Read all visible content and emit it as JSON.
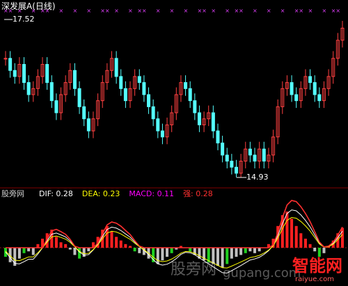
{
  "header": {
    "title": "深发展A",
    "period": "(日线)"
  },
  "price_pane": {
    "high_marker": "17.52",
    "low_marker": "14.93",
    "signal_row_color": "#e040fb",
    "up_color": "#ff4040",
    "down_color": "#54ffff"
  },
  "macd_pane": {
    "indicator_name": "股旁网",
    "dif_label": "DIF:",
    "dif_value": "0.28",
    "dea_label": "DEA:",
    "dea_value": "0.23",
    "macd_label": "MACD:",
    "macd_value": "0.11",
    "strong_label": "强:",
    "strong_value": "0.28",
    "colors": {
      "dif": "#ffffff",
      "dea": "#ffff00",
      "macd": "#ff00ff",
      "strong": "#ff3030",
      "hist_up": "#ff2020",
      "hist_down": "#c0c0c0",
      "hist_green": "#20d020"
    }
  },
  "watermark": {
    "left_text": "股旁网",
    "right_text": "智能网",
    "url": "gupang.com",
    "sub_url": "raiyue.com"
  },
  "chart_data": {
    "type": "candlestick",
    "series_ohlc_note": "approximate daily bars read from image",
    "price_high": 17.52,
    "price_low": 14.93,
    "closes": [
      16.9,
      16.7,
      16.6,
      16.8,
      16.5,
      16.3,
      16.4,
      16.6,
      16.8,
      16.5,
      16.2,
      16.0,
      16.3,
      16.5,
      16.7,
      16.4,
      16.1,
      15.9,
      15.7,
      15.9,
      16.2,
      16.5,
      16.7,
      16.9,
      16.6,
      16.4,
      16.2,
      16.4,
      16.6,
      16.5,
      16.3,
      16.1,
      15.9,
      15.7,
      15.6,
      15.8,
      16.0,
      16.3,
      16.5,
      16.4,
      16.2,
      16.0,
      15.8,
      15.9,
      16.0,
      15.7,
      15.5,
      15.3,
      15.2,
      15.1,
      15.0,
      15.2,
      15.4,
      15.3,
      15.2,
      15.4,
      15.2,
      15.3,
      15.6,
      16.1,
      16.4,
      16.5,
      16.3,
      16.2,
      16.4,
      16.6,
      16.5,
      16.3,
      16.2,
      16.4,
      16.6,
      16.9,
      17.2,
      17.4
    ],
    "macd_hist": [
      -0.05,
      -0.08,
      -0.1,
      -0.06,
      -0.03,
      -0.02,
      -0.04,
      0.02,
      0.05,
      0.08,
      0.1,
      0.06,
      0.03,
      0.02,
      -0.01,
      -0.04,
      -0.06,
      -0.05,
      -0.02,
      0.03,
      0.06,
      0.1,
      0.12,
      0.09,
      0.06,
      0.04,
      0.02,
      0.01,
      -0.02,
      -0.03,
      -0.04,
      -0.06,
      -0.08,
      -0.09,
      -0.07,
      -0.05,
      -0.03,
      -0.01,
      0.01,
      0.0,
      -0.02,
      -0.04,
      -0.06,
      -0.07,
      -0.08,
      -0.09,
      -0.1,
      -0.11,
      -0.09,
      -0.06,
      -0.05,
      -0.04,
      -0.03,
      -0.02,
      -0.03,
      -0.02,
      0.0,
      0.02,
      0.05,
      0.12,
      0.18,
      0.2,
      0.16,
      0.12,
      0.08,
      0.05,
      0.02,
      -0.02,
      -0.05,
      -0.03,
      0.01,
      0.04,
      0.08,
      0.11
    ]
  }
}
